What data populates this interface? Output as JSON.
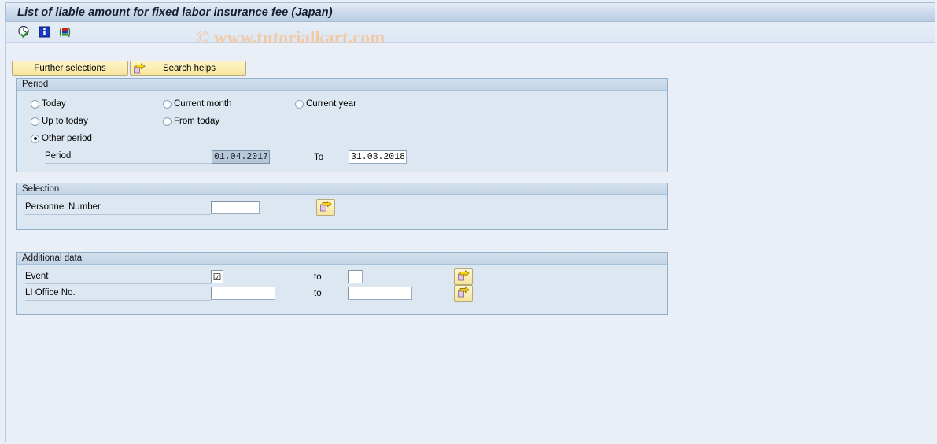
{
  "window": {
    "title": "List of liable amount for fixed labor insurance fee (Japan)",
    "watermark": "© www.tutorialkart.com"
  },
  "toolbar": {
    "icons": [
      {
        "name": "execute-clock-icon",
        "tooltip": "Execute"
      },
      {
        "name": "information-icon",
        "tooltip": "Information"
      },
      {
        "name": "variant-icon",
        "tooltip": "Get Variant"
      }
    ]
  },
  "buttons": {
    "further_selections": "Further selections",
    "search_helps": "Search helps"
  },
  "period_panel": {
    "title": "Period",
    "options": [
      {
        "label": "Today",
        "selected": false
      },
      {
        "label": "Current month",
        "selected": false
      },
      {
        "label": "Current year",
        "selected": false
      },
      {
        "label": "Up to today",
        "selected": false
      },
      {
        "label": "From today",
        "selected": false
      },
      {
        "label": "Other period",
        "selected": true
      }
    ],
    "period_label": "Period",
    "period_from": "01.04.2017",
    "to_label": "To",
    "period_to": "31.03.2018"
  },
  "selection_panel": {
    "title": "Selection",
    "personnel_number_label": "Personnel Number",
    "personnel_number_value": "",
    "multi_select_tooltip": "Multiple selection"
  },
  "additional_panel": {
    "title": "Additional data",
    "rows": [
      {
        "label": "Event",
        "value": "☑",
        "to_label": "to",
        "to_value": "",
        "multi_select_tooltip": "Multiple selection"
      },
      {
        "label": "LI Office No.",
        "value": "",
        "to_label": "to",
        "to_value": "",
        "multi_select_tooltip": "Multiple selection"
      }
    ]
  },
  "colors": {
    "window_background": "#e9eef7",
    "panel_background": "#dde7f1",
    "panel_border": "#91aecb",
    "title_text": "#141e32",
    "button_yellow": "#fbeeb4",
    "watermark": "#f3c8a4",
    "selected_field": "#b6c7da"
  }
}
